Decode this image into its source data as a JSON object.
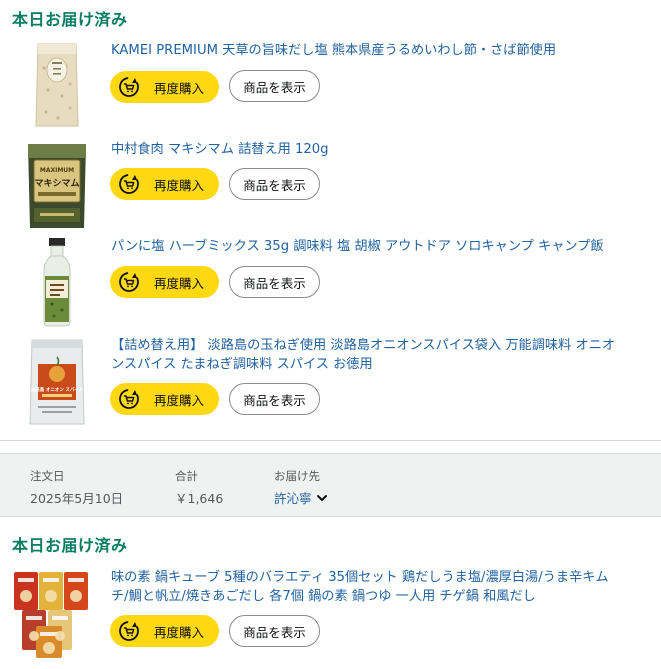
{
  "groups": [
    {
      "status": "本日お届け済み",
      "items": [
        {
          "title": "KAMEI PREMIUM 天草の旨味だし塩 熊本県産うるめいわし節・さば節使用",
          "rebuy_label": "再度購入",
          "view_label": "商品を表示"
        },
        {
          "title": "中村食肉 マキシマム 詰替え用 120g",
          "rebuy_label": "再度購入",
          "view_label": "商品を表示"
        },
        {
          "title": "パンに塩 ハーブミックス 35g 調味料 塩 胡椒 アウトドア ソロキャンプ キャンプ飯",
          "rebuy_label": "再度購入",
          "view_label": "商品を表示"
        },
        {
          "title_lines": [
            "【詰め替え用】 淡路島の玉ねぎ使用 淡路島オニオンスパイス袋入 万能調味料 オニオ",
            "ンスパイス たまねぎ調味料 スパイス お徳用"
          ],
          "rebuy_label": "再度購入",
          "view_label": "商品を表示"
        }
      ]
    },
    {
      "status": "本日お届け済み",
      "items": [
        {
          "title_lines": [
            "味の素 鍋キューブ 5種のバラエティ 35個セット 鶏だしうま塩/濃厚白湯/うま辛キム",
            "チ/鯛と帆立/焼きあごだし 各7個 鍋の素 鍋つゆ 一人用 チゲ鍋 和風だし"
          ],
          "rebuy_label": "再度購入",
          "view_label": "商品を表示"
        }
      ]
    }
  ],
  "order_summary": {
    "order_date_label": "注文日",
    "order_date": "2025年5月10日",
    "total_label": "合計",
    "total": "￥1,646",
    "ship_to_label": "お届け先",
    "ship_to": "許沁寧"
  },
  "product_label_texts": {
    "maxim_brand": "MAXIMUM",
    "maxim_name": "マキシマム",
    "onion_name": "淡路島 オニオン スパイス"
  },
  "colors": {
    "status_green": "#067d62",
    "link_blue": "#2162a1",
    "button_yellow": "#ffd814",
    "summary_bg": "#f0f2f2"
  }
}
